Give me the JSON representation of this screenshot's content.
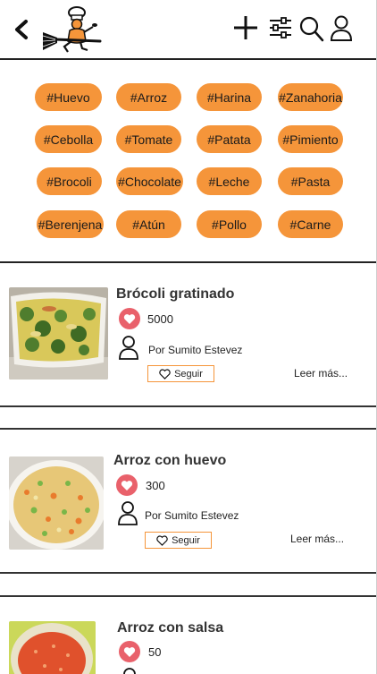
{
  "header": {
    "back_icon": "chevron-left-icon",
    "logo": "chef-on-broom-logo",
    "actions": [
      "plus-icon",
      "sliders-icon",
      "search-icon",
      "user-icon"
    ]
  },
  "tags": [
    "#Huevo",
    "#Arroz",
    "#Harina",
    "#Zanahoria",
    "#Cebolla",
    "#Tomate",
    "#Patata",
    "#Pimiento",
    "#Brocoli",
    "#Chocolate",
    "#Leche",
    "#Pasta",
    "#Berenjena",
    "#Atún",
    "#Pollo",
    "#Carne"
  ],
  "recipes": [
    {
      "title": "Brócoli gratinado",
      "likes": "5000",
      "author": "Por Sumito Estevez",
      "follow_label": "Seguir",
      "read_more": "Leer más..."
    },
    {
      "title": "Arroz con huevo",
      "likes": "300",
      "author": "Por Sumito Estevez",
      "follow_label": "Seguir",
      "read_more": "Leer más..."
    },
    {
      "title": "Arroz con salsa",
      "likes": "50",
      "author": "",
      "follow_label": "",
      "read_more": ""
    }
  ],
  "colors": {
    "tag_bg": "#f5953a",
    "heart_badge": "#e9616b",
    "follow_border": "#f5953a"
  }
}
